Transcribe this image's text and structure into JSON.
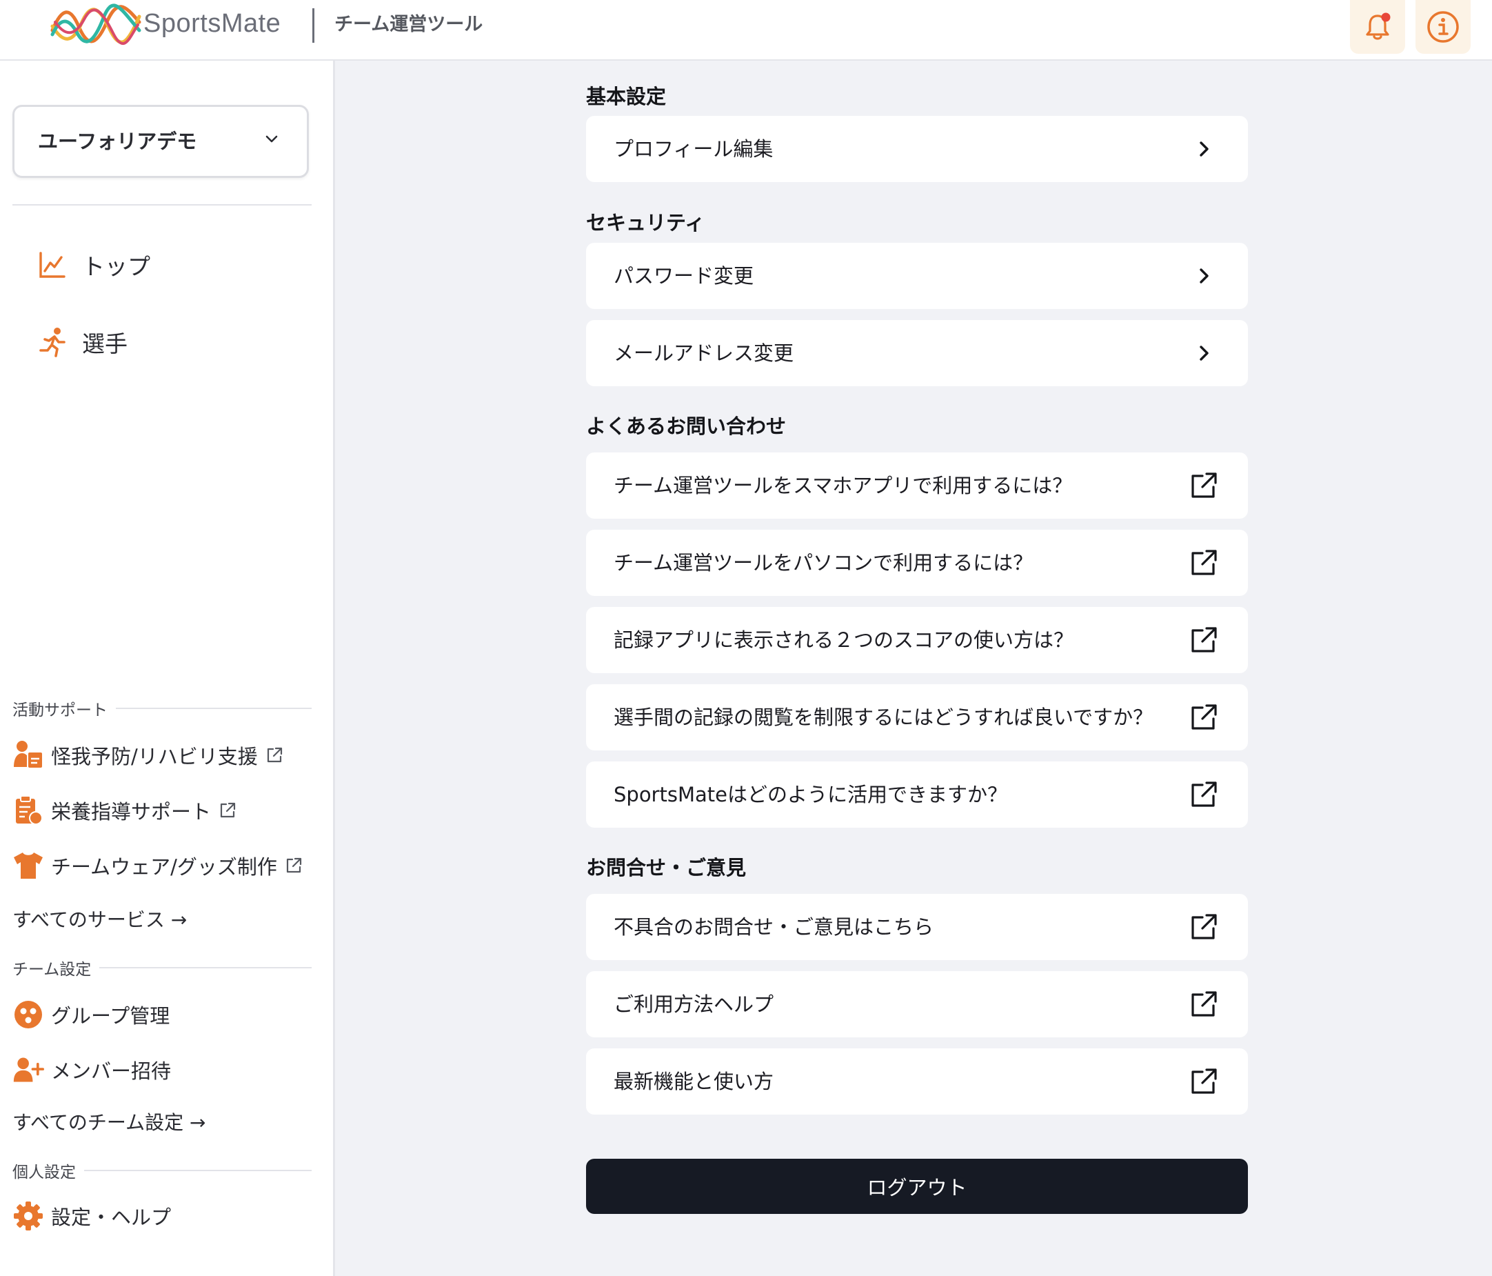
{
  "header": {
    "brand": "SportsMate",
    "subtitle": "チーム運営ツール",
    "icons": [
      "bell-icon",
      "info-icon"
    ],
    "accent_color": "#e8772e",
    "notification_dot_color": "#e8473a"
  },
  "sidebar": {
    "team_name": "ユーフォリアデモ",
    "nav": [
      {
        "label": "トップ",
        "icon": "chart-line-icon"
      },
      {
        "label": "選手",
        "icon": "runner-icon"
      }
    ],
    "activity_support": {
      "heading": "活動サポート",
      "items": [
        {
          "label": "怪我予防/リハビリ支援",
          "icon": "medical-person-icon"
        },
        {
          "label": "栄養指導サポート",
          "icon": "clipboard-apple-icon"
        },
        {
          "label": "チームウェア/グッズ制作",
          "icon": "tshirt-icon"
        }
      ],
      "all_link": "すべてのサービス →"
    },
    "team_settings": {
      "heading": "チーム設定",
      "items": [
        {
          "label": "グループ管理",
          "icon": "group-icon"
        },
        {
          "label": "メンバー招待",
          "icon": "person-add-icon"
        }
      ],
      "all_link": "すべてのチーム設定 →"
    },
    "personal_settings": {
      "heading": "個人設定",
      "items": [
        {
          "label": "設定・ヘルプ",
          "icon": "gear-icon"
        }
      ]
    }
  },
  "main": {
    "groups": [
      {
        "title": "基本設定",
        "items": [
          {
            "label": "プロフィール編集",
            "type": "chevron"
          }
        ]
      },
      {
        "title": "セキュリティ",
        "items": [
          {
            "label": "パスワード変更",
            "type": "chevron"
          },
          {
            "label": "メールアドレス変更",
            "type": "chevron"
          }
        ]
      },
      {
        "title": "よくあるお問い合わせ",
        "items": [
          {
            "label": "チーム運営ツールをスマホアプリで利用するには？",
            "type": "external"
          },
          {
            "label": "チーム運営ツールをパソコンで利用するには？",
            "type": "external"
          },
          {
            "label": "記録アプリに表示される２つのスコアの使い方は？",
            "type": "external"
          },
          {
            "label": "選手間の記録の閲覧を制限するにはどうすれば良いですか？",
            "type": "external"
          },
          {
            "label": "SportsMateはどのように活用できますか？",
            "type": "external"
          }
        ]
      },
      {
        "title": "お問合せ・ご意見",
        "items": [
          {
            "label": "不具合のお問合せ・ご意見はこちら",
            "type": "external"
          },
          {
            "label": "ご利用方法ヘルプ",
            "type": "external"
          },
          {
            "label": "最新機能と使い方",
            "type": "external"
          }
        ]
      }
    ],
    "logout_label": "ログアウト"
  }
}
